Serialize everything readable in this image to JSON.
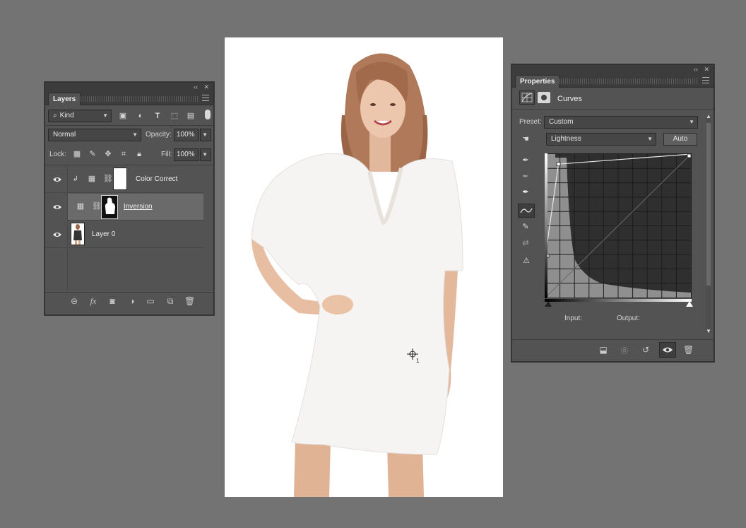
{
  "layers_panel": {
    "tab": "Layers",
    "filter_kind": "Kind",
    "blend_mode": "Normal",
    "opacity_label": "Opacity:",
    "opacity_value": "100%",
    "lock_label": "Lock:",
    "fill_label": "Fill:",
    "fill_value": "100%",
    "layers": [
      {
        "name": "Color Correct",
        "clipped": true
      },
      {
        "name": "Inversion",
        "selected": true
      },
      {
        "name": "Layer 0"
      }
    ],
    "footer_fx": "fx"
  },
  "properties_panel": {
    "tab": "Properties",
    "adjustment": "Curves",
    "preset_label": "Preset:",
    "preset_value": "Custom",
    "channel_value": "Lightness",
    "auto_label": "Auto",
    "input_label": "Input:",
    "output_label": "Output:",
    "curve_points": [
      [
        0,
        0.29
      ],
      [
        0.09,
        0.93
      ],
      [
        1,
        1
      ]
    ]
  },
  "canvas": {
    "cursor_label": "1"
  },
  "colors": {
    "app_bg": "#737373",
    "panel_bg": "#535353",
    "doc_bg": "#ffffff"
  }
}
